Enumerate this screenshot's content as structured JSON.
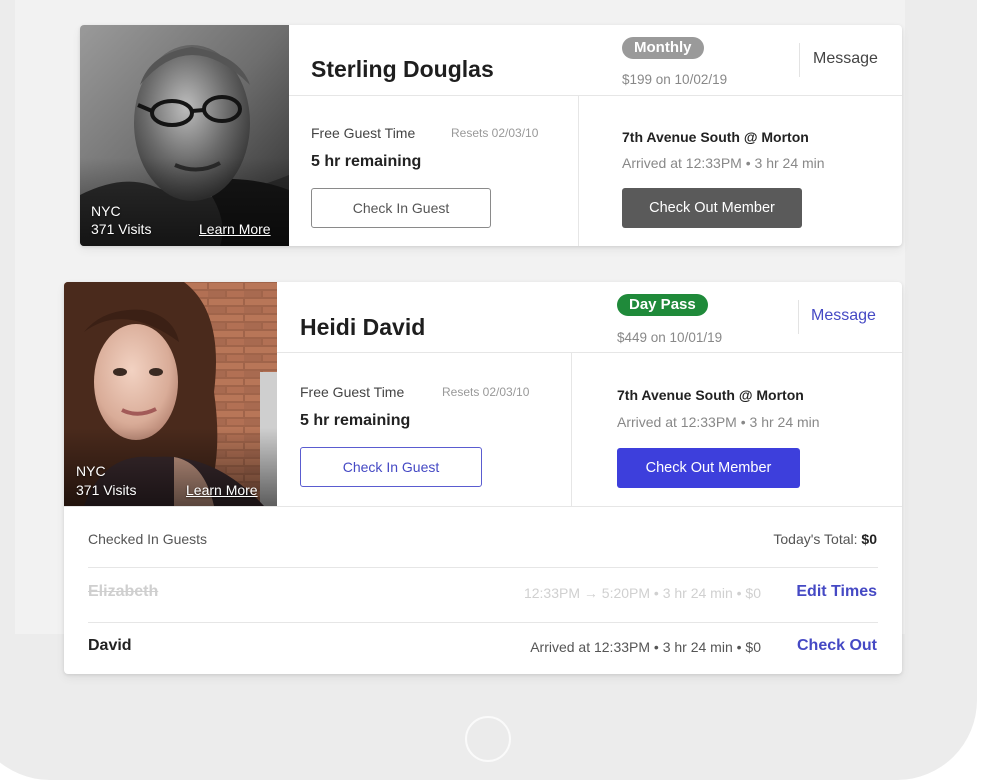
{
  "colors": {
    "accent": "#3d3fdc",
    "link": "#4549c4",
    "monthly_pill": "#9a9a9a",
    "daypass_pill": "#1f8a3a",
    "checkout_disabled": "#5a5a5a"
  },
  "members": [
    {
      "name": "Sterling Douglas",
      "city": "NYC",
      "visits": "371 Visits",
      "learn_more": "Learn More",
      "plan": "Monthly",
      "plan_price": "$199 on 10/02/19",
      "message": "Message",
      "guest_time_label": "Free Guest Time",
      "resets": "Resets 02/03/10",
      "remaining": "5 hr remaining",
      "check_in_guest": "Check In Guest",
      "location": "7th Avenue South @ Morton",
      "arrived": "Arrived at 12:33PM  •  3 hr 24 min",
      "check_out": "Check Out Member"
    },
    {
      "name": "Heidi David",
      "city": "NYC",
      "visits": "371 Visits",
      "learn_more": "Learn More",
      "plan": "Day Pass",
      "plan_price": "$449 on 10/01/19",
      "message": "Message",
      "guest_time_label": "Free Guest Time",
      "resets": "Resets 02/03/10",
      "remaining": "5 hr remaining",
      "check_in_guest": "Check In Guest",
      "location": "7th Avenue South @ Morton",
      "arrived": "Arrived at 12:33PM  •  3 hr 24 min",
      "check_out": "Check Out Member"
    }
  ],
  "guests": {
    "header": "Checked In Guests",
    "total_label": "Today's Total:",
    "total_value": "$0",
    "rows": [
      {
        "name": "Elizabeth",
        "info": "12:33PM → 5:20PM  •  3 hr 24 min  •  $0",
        "action": "Edit Times"
      },
      {
        "name": "David",
        "info": "Arrived at 12:33PM  •  3 hr 24 min  •  $0",
        "action": "Check Out"
      }
    ]
  }
}
